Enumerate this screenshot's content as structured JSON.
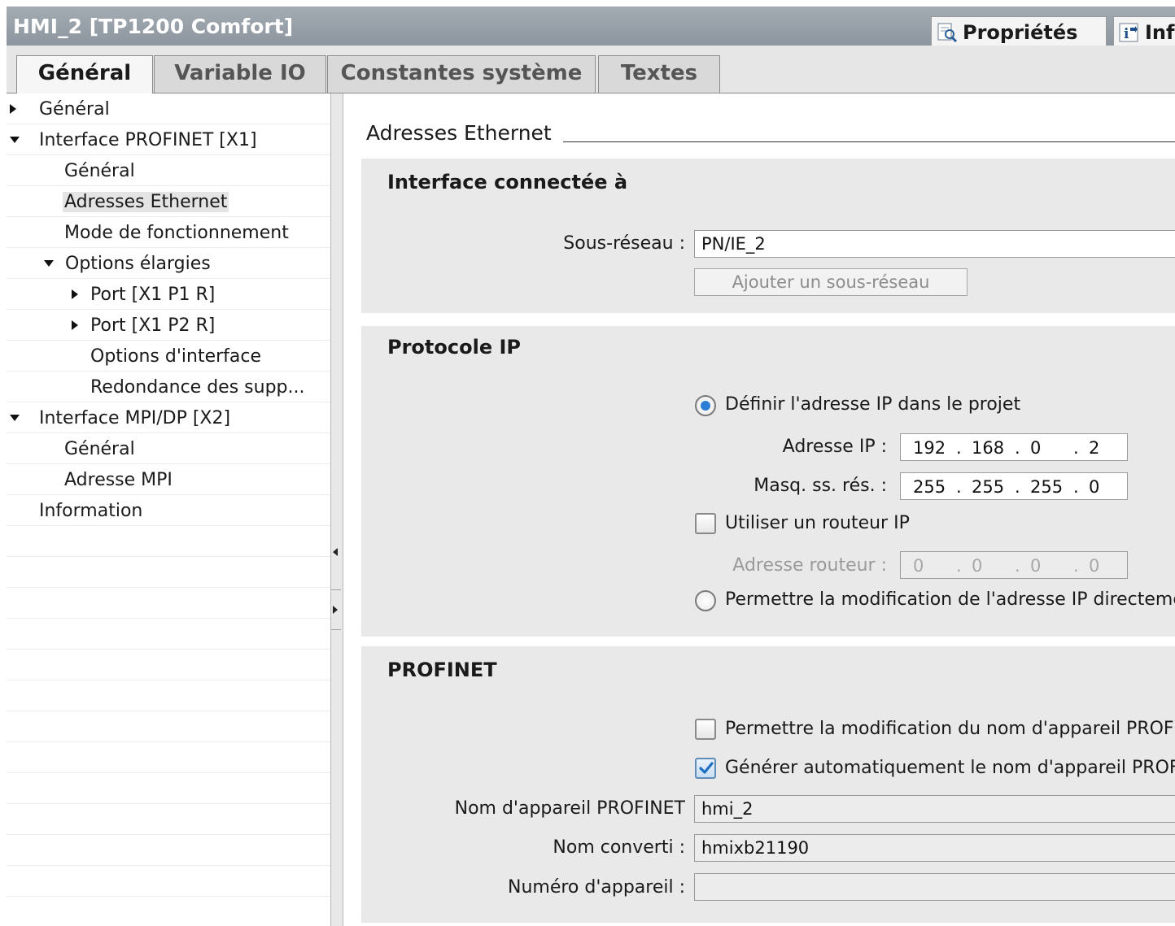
{
  "window": {
    "title": "HMI_2 [TP1200 Comfort]",
    "properties_tab": "Propriétés",
    "info_tab": "Inf"
  },
  "tabs": [
    "Général",
    "Variable IO",
    "Constantes système",
    "Textes"
  ],
  "tree": {
    "items": [
      "Général",
      "Interface PROFINET [X1]",
      "Général",
      "Adresses Ethernet",
      "Mode de fonctionnement",
      "Options élargies",
      "Port [X1 P1 R]",
      "Port [X1 P2 R]",
      "Options d'interface",
      "Redondance des supp...",
      "Interface MPI/DP [X2]",
      "Général",
      "Adresse MPI",
      "Information"
    ]
  },
  "content": {
    "section_title": "Adresses Ethernet",
    "interface": {
      "title": "Interface connectée à",
      "subnet_label": "Sous-réseau :",
      "subnet_value": "PN/IE_2",
      "add_subnet_button": "Ajouter un sous-réseau"
    },
    "ip": {
      "title": "Protocole IP",
      "define_in_project": "Définir l'adresse IP dans le projet",
      "ip_label": "Adresse IP :",
      "ip_octets": [
        "192",
        ".",
        "168",
        ".",
        "0",
        ".",
        "2"
      ],
      "mask_label": "Masq. ss. rés. :",
      "mask_octets": [
        "255",
        ".",
        "255",
        ".",
        "255",
        ".",
        "0"
      ],
      "use_router": "Utiliser un routeur IP",
      "router_label": "Adresse routeur :",
      "router_octets": [
        "0",
        ".",
        "0",
        ".",
        "0",
        ".",
        "0"
      ],
      "allow_direct": "Permettre la modification de l'adresse IP directeme"
    },
    "profinet": {
      "title": "PROFINET",
      "allow_name_change": "Permettre la modification du nom d'appareil PROFI",
      "auto_generate": "Générer automatiquement le nom d'appareil PROFI",
      "device_name_label": "Nom d'appareil PROFINET",
      "device_name_value": "hmi_2",
      "converted_name_label": "Nom converti :",
      "converted_name_value": "hmixb21190",
      "device_number_label": "Numéro d'appareil :",
      "device_number_value": ""
    }
  }
}
